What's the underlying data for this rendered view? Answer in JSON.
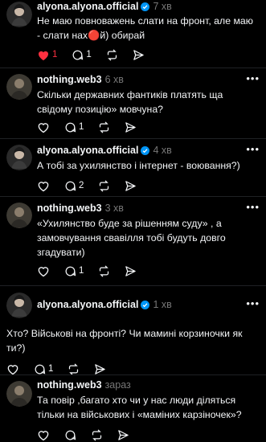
{
  "posts": [
    {
      "username": "alyona.alyona.official",
      "verified": true,
      "time": "7 хв",
      "text": "Не маю повноважень слати на фронт, але маю - слати нах🔴й) обирай",
      "likes": "1",
      "replies": "1",
      "liked": true
    },
    {
      "username": "nothing.web3",
      "verified": false,
      "time": "6 хв",
      "text": "Скільки державних фантиків платять ща свідому позицію» мовчуна?",
      "likes": "",
      "replies": "1"
    },
    {
      "username": "alyona.alyona.official",
      "verified": true,
      "time": "4 хв",
      "text": "А тобі за ухилянство і інтернет - воювання?)",
      "likes": "",
      "replies": "2"
    },
    {
      "username": "nothing.web3",
      "verified": false,
      "time": "3 хв",
      "text": "«Ухилянство буде за рішенням суду» , а замовчування свавілля тобі будуть довго згадувати)",
      "likes": "",
      "replies": "1"
    },
    {
      "username": "alyona.alyona.official",
      "verified": true,
      "time": "1 хв",
      "text": "Хто? Військові на фронті? Чи мамині корзиночки як ти?)",
      "likes": "",
      "replies": "1"
    },
    {
      "username": "nothing.web3",
      "verified": false,
      "time": "зараз",
      "text": "Та повір ,багато хто чи у нас люди діляться тільки на військових і «маміних карзіночек»?",
      "likes": "",
      "replies": ""
    }
  ],
  "more_label": "•••",
  "colors": {
    "background": "#000000",
    "text": "#f3f5f7",
    "muted": "#777777",
    "like_red": "#ff3040",
    "verified_blue": "#0095f6"
  }
}
